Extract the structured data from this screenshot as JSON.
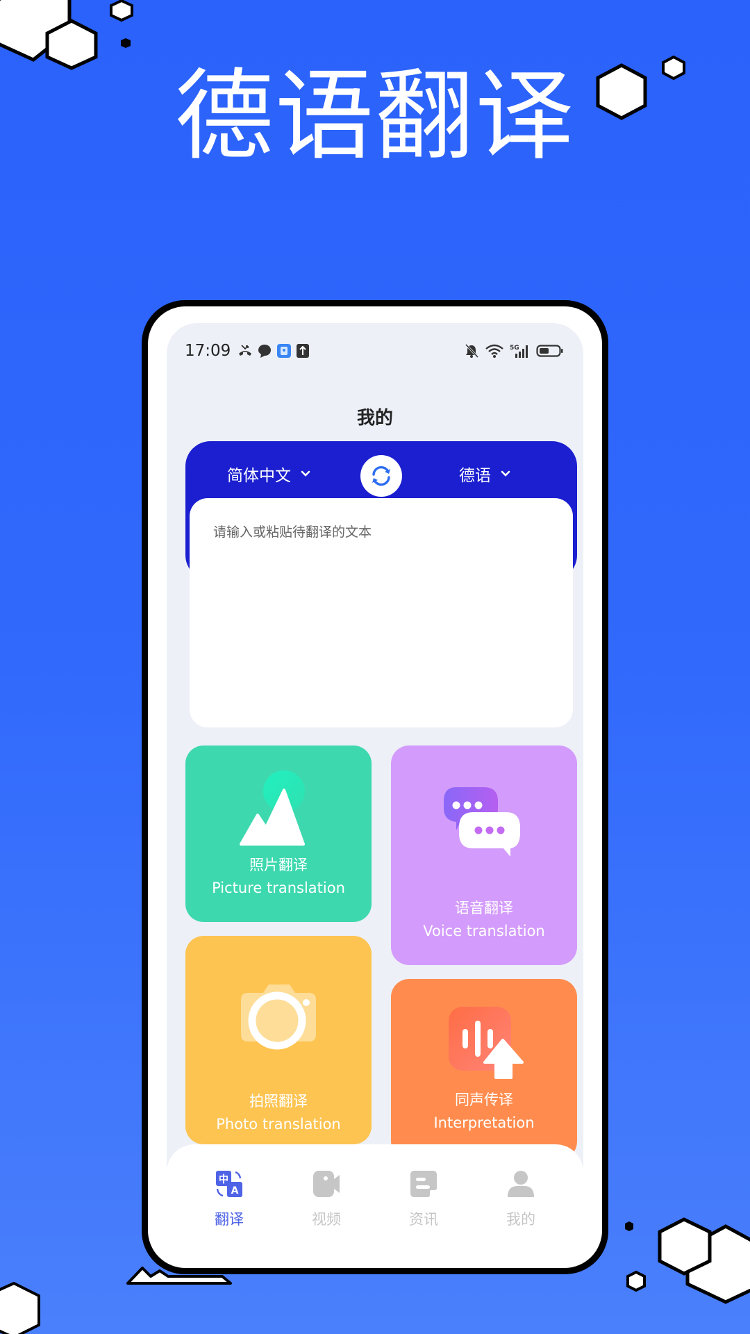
{
  "hero": {
    "title": "德语翻译"
  },
  "colors": {
    "background_top": "#2a62fb",
    "background_bottom": "#4a80fb",
    "lang_header": "#1b1fcf",
    "screen_bg": "#edf0f7",
    "nav_active": "#4f63e6",
    "nav_inactive": "#c6c6c6",
    "card_picture": "#3dd8ae",
    "card_voice": "#d39bfb",
    "card_photo": "#fdc452",
    "card_interpretation": "#ff8c4e"
  },
  "status_bar": {
    "time": "17:09",
    "left_icons": [
      "missed-call-icon",
      "message-bubble-icon",
      "app-notification-icon",
      "upload-icon"
    ],
    "right_icons": [
      "mute-bell-icon",
      "wifi-icon",
      "5g-signal-icon",
      "battery-icon"
    ],
    "network": "5G"
  },
  "page": {
    "title": "我的"
  },
  "translator": {
    "source_lang": "简体中文",
    "target_lang": "德语",
    "swap_icon": "swap-refresh-icon",
    "input_placeholder": "请输入或粘贴待翻译的文本",
    "input_value": ""
  },
  "features": [
    {
      "id": "picture",
      "label_zh": "照片翻译",
      "label_en": "Picture translation",
      "icon": "mountain-image-icon"
    },
    {
      "id": "voice",
      "label_zh": "语音翻译",
      "label_en": "Voice translation",
      "icon": "chat-bubbles-icon"
    },
    {
      "id": "photo",
      "label_zh": "拍照翻译",
      "label_en": "Photo translation",
      "icon": "camera-icon"
    },
    {
      "id": "interpretation",
      "label_zh": "同声传译",
      "label_en": "Interpretation",
      "icon": "soundwave-upload-icon"
    }
  ],
  "bottom_nav": [
    {
      "label": "翻译",
      "icon": "translate-icon",
      "active": true
    },
    {
      "label": "视频",
      "icon": "video-camera-icon",
      "active": false
    },
    {
      "label": "资讯",
      "icon": "news-doc-icon",
      "active": false
    },
    {
      "label": "我的",
      "icon": "user-profile-icon",
      "active": false
    }
  ]
}
